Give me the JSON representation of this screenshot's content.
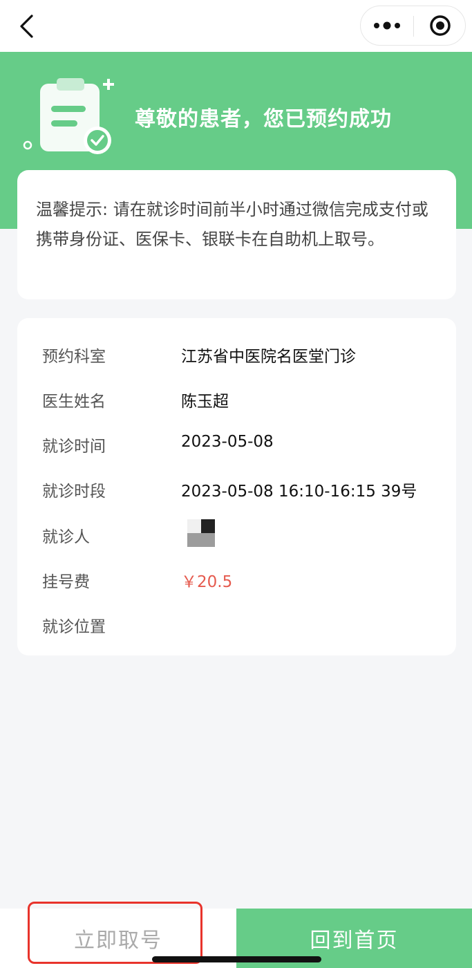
{
  "banner": {
    "title": "尊敬的患者，您已预约成功"
  },
  "tip": {
    "text": "温馨提示: 请在就诊时间前半小时通过微信完成支付或携带身份证、医保卡、银联卡在自助机上取号。"
  },
  "info": {
    "rows": [
      {
        "label": "预约科室",
        "value": "江苏省中医院名医堂门诊"
      },
      {
        "label": "医生姓名",
        "value": "陈玉超"
      },
      {
        "label": "就诊时间",
        "value": "2023-05-08"
      },
      {
        "label": "就诊时段",
        "value": "2023-05-08 16:10-16:15 39号"
      },
      {
        "label": "就诊人",
        "value": ""
      },
      {
        "label": "挂号费",
        "value": "￥20.5"
      },
      {
        "label": "就诊位置",
        "value": ""
      }
    ]
  },
  "bottom": {
    "take_label": "立即取号",
    "home_label": "回到首页"
  },
  "colors": {
    "brand_green": "#66cc88",
    "fee_red": "#e55a4e",
    "highlight_red": "#e8332b"
  },
  "icons": {
    "back": "chevron-left-icon",
    "more": "more-dots-icon",
    "close": "target-circle-icon",
    "illustration": "clipboard-check-icon"
  }
}
